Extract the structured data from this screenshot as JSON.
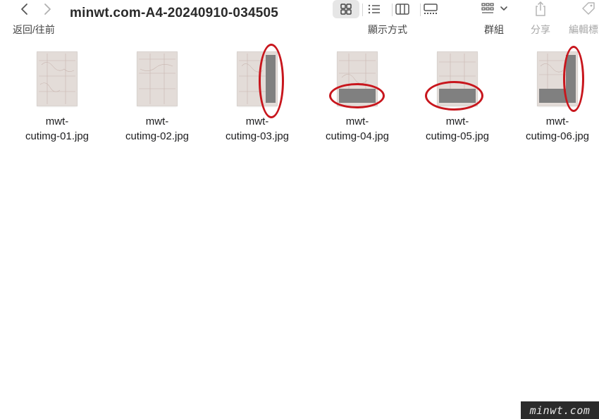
{
  "toolbar": {
    "back_forward_label": "返回/往前",
    "title": "minwt.com-A4-20240910-034505",
    "view_mode_label": "顯示方式",
    "group_label": "群組",
    "share_label": "分享",
    "tag_label": "編輯標"
  },
  "files": [
    {
      "name_line1": "mwt-",
      "name_line2": "cutimg-01.jpg",
      "crop": "none"
    },
    {
      "name_line1": "mwt-",
      "name_line2": "cutimg-02.jpg",
      "crop": "none"
    },
    {
      "name_line1": "mwt-",
      "name_line2": "cutimg-03.jpg",
      "crop": "right"
    },
    {
      "name_line1": "mwt-",
      "name_line2": "cutimg-04.jpg",
      "crop": "bottom"
    },
    {
      "name_line1": "mwt-",
      "name_line2": "cutimg-05.jpg",
      "crop": "bottom"
    },
    {
      "name_line1": "mwt-",
      "name_line2": "cutimg-06.jpg",
      "crop": "right-bottom"
    }
  ],
  "annotation_color": "#c8161d",
  "watermark": "minwt.com"
}
